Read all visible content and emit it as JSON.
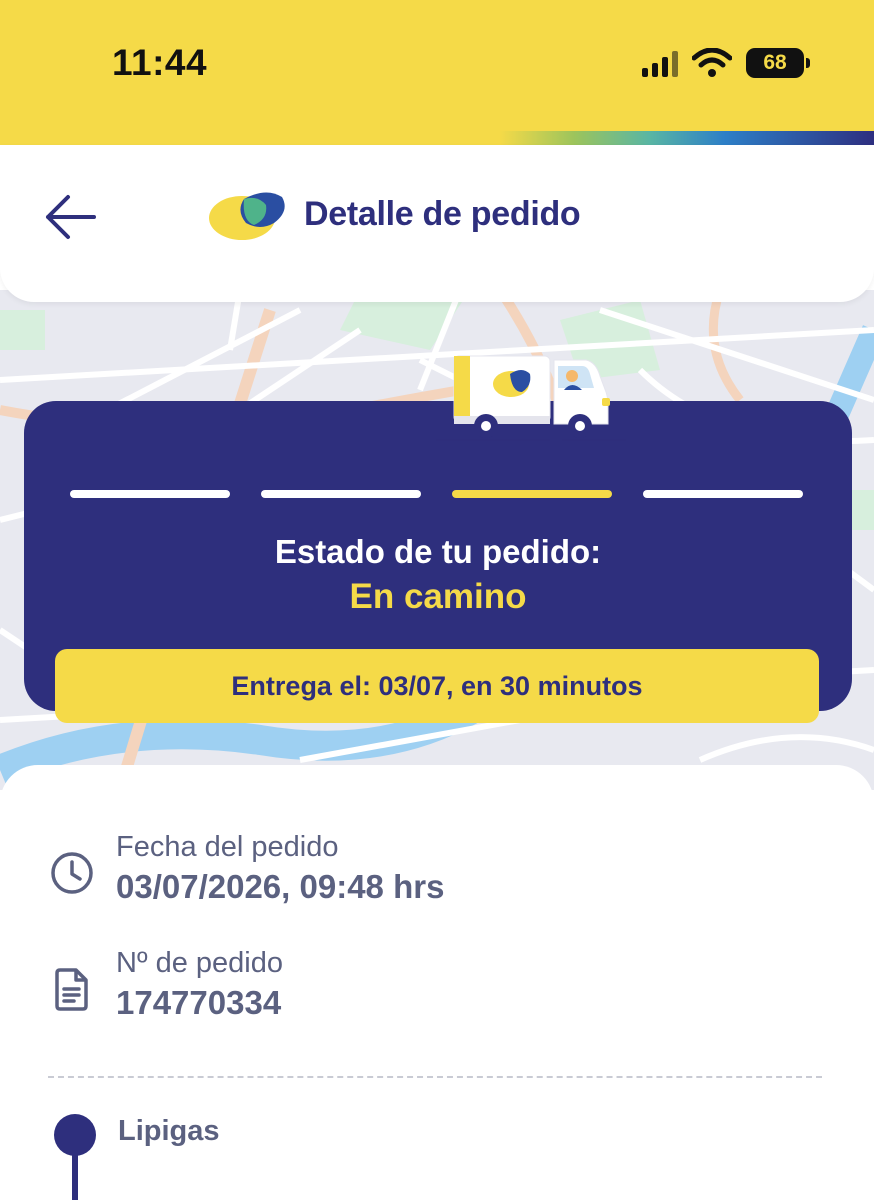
{
  "status_bar": {
    "time": "11:44",
    "battery": "68"
  },
  "header": {
    "title": "Detalle de pedido"
  },
  "order_status": {
    "label": "Estado de tu pedido:",
    "value": "En camino",
    "delivery": "Entrega el: 03/07, en 30 minutos",
    "steps_total": 4,
    "active_step": 3
  },
  "details": {
    "date_label": "Fecha del pedido",
    "date_value": "03/07/2026, 09:48 hrs",
    "order_label": "Nº de pedido",
    "order_value": "174770334"
  },
  "merchant": {
    "name": "Lipigas"
  },
  "colors": {
    "brand_yellow": "#f5da48",
    "brand_navy": "#2e2f7d",
    "text_gray": "#5b6180"
  }
}
